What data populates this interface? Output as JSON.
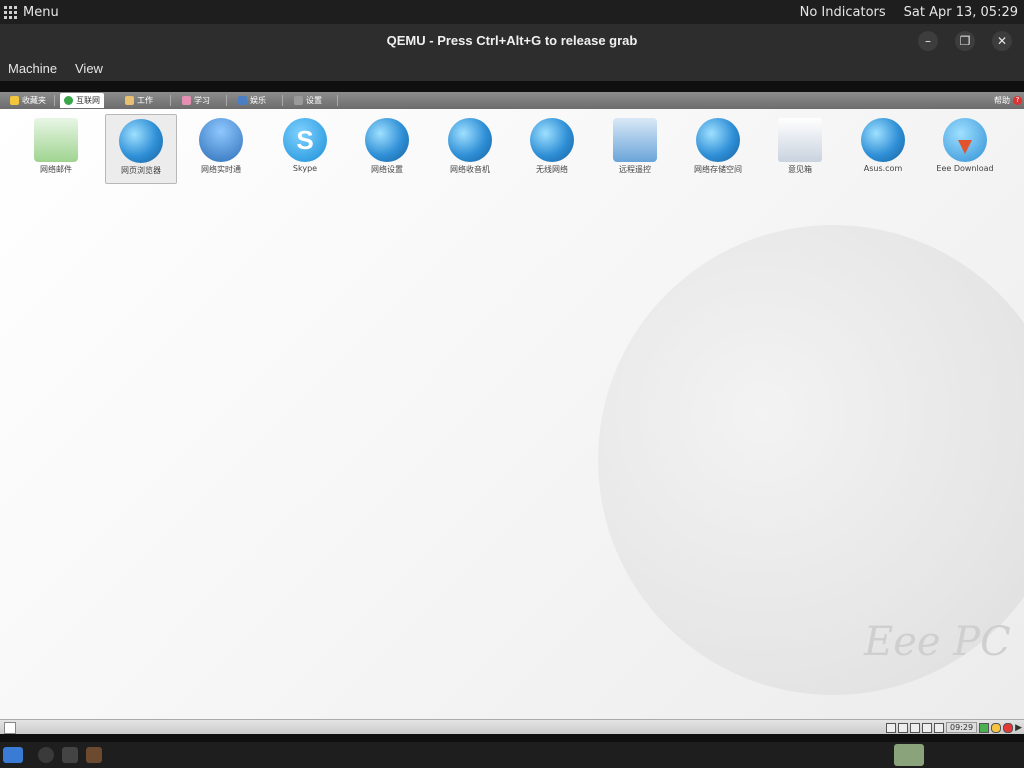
{
  "host_topbar": {
    "menu_label": "Menu",
    "indicators": "No Indicators",
    "datetime": "Sat Apr 13, 05:29"
  },
  "window": {
    "title": "QEMU - Press Ctrl+Alt+G to release grab",
    "menus": [
      "Machine",
      "View"
    ]
  },
  "guest": {
    "tabs": [
      {
        "label": "收藏夹",
        "active": false
      },
      {
        "label": "互联网",
        "active": true
      },
      {
        "label": "工作",
        "active": false
      },
      {
        "label": "学习",
        "active": false
      },
      {
        "label": "娱乐",
        "active": false
      },
      {
        "label": "设置",
        "active": false
      }
    ],
    "help_label": "帮助",
    "apps": [
      {
        "label": "网络邮件",
        "icon": "mail-icon",
        "selected": false
      },
      {
        "label": "网页浏览器",
        "icon": "globe-browser-icon",
        "selected": true
      },
      {
        "label": "网络实时通",
        "icon": "messenger-icon",
        "selected": false
      },
      {
        "label": "Skype",
        "icon": "skype-icon",
        "selected": false
      },
      {
        "label": "网络设置",
        "icon": "network-settings-icon",
        "selected": false
      },
      {
        "label": "网络收音机",
        "icon": "radio-icon",
        "selected": false
      },
      {
        "label": "无线网络",
        "icon": "wireless-icon",
        "selected": false
      },
      {
        "label": "远程遥控",
        "icon": "remote-control-icon",
        "selected": false
      },
      {
        "label": "网络存储空间",
        "icon": "storage-icon",
        "selected": false
      },
      {
        "label": "意见箱",
        "icon": "feedback-icon",
        "selected": false
      },
      {
        "label": "Asus.com",
        "icon": "asus-globe-icon",
        "selected": false
      },
      {
        "label": "Eee Download",
        "icon": "download-icon",
        "selected": false
      }
    ],
    "brand": "Eee PC",
    "tray_clock": "09:29"
  }
}
